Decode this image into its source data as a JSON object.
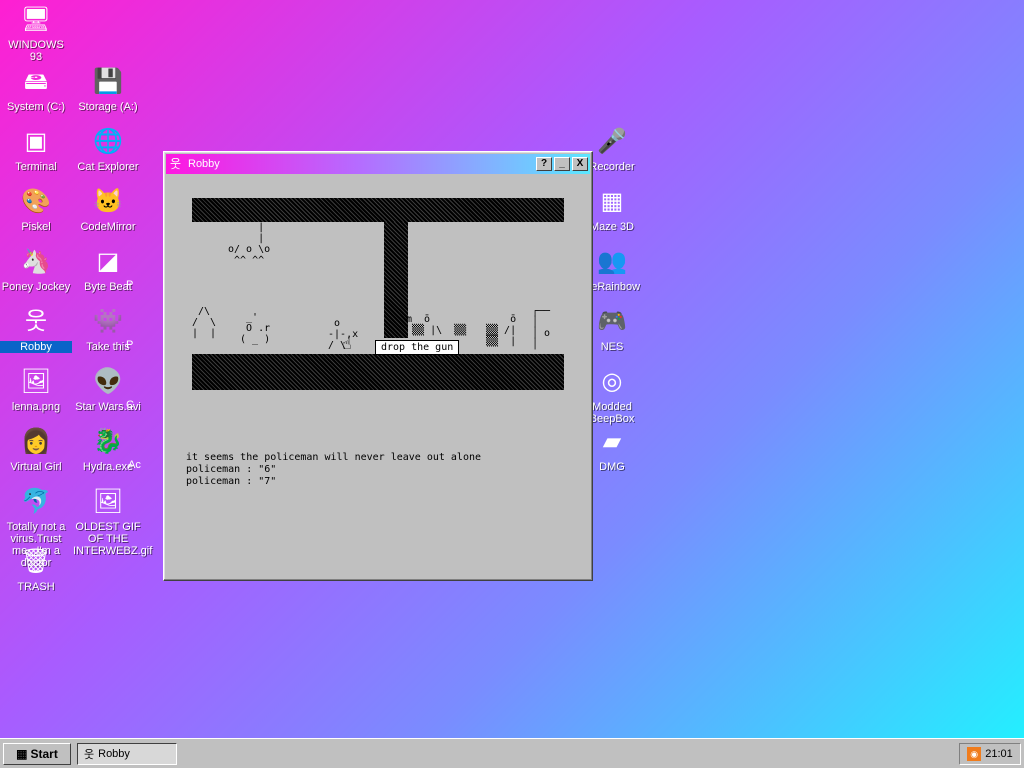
{
  "desktop": {
    "icons": [
      {
        "label": "WINDOWS 93",
        "glyph": "🖥",
        "icon": "computer-icon"
      },
      {
        "label": "System (C:)",
        "glyph": "🖴",
        "icon": "drive-icon"
      },
      {
        "label": "Storage (A:)",
        "glyph": "💾",
        "icon": "floppy-icon"
      },
      {
        "label": "Terminal",
        "glyph": "▣",
        "icon": "terminal-icon"
      },
      {
        "label": "Cat Explorer",
        "glyph": "🌐",
        "icon": "globe-icon"
      },
      {
        "label": "Piskel",
        "glyph": "🎨",
        "icon": "palette-icon"
      },
      {
        "label": "CodeMirror",
        "glyph": "🐱",
        "icon": "cat-icon"
      },
      {
        "label": "Poney Jockey",
        "glyph": "🦄",
        "icon": "pony-icon"
      },
      {
        "label": "Byte Beat",
        "glyph": "◪",
        "icon": "bytebeat-icon"
      },
      {
        "label": "Robby",
        "glyph": "웃",
        "icon": "stickman-icon"
      },
      {
        "label": "Take this",
        "glyph": "👾",
        "icon": "monster-icon"
      },
      {
        "label": "lenna.png",
        "glyph": "🖼",
        "icon": "image-file-icon"
      },
      {
        "label": "Star Wars.avi",
        "glyph": "👽",
        "icon": "yoda-icon"
      },
      {
        "label": "Virtual Girl",
        "glyph": "👩",
        "icon": "face-icon"
      },
      {
        "label": "Hydra.exe",
        "glyph": "🐉",
        "icon": "dragon-icon"
      },
      {
        "label": "Totally not a virus.Trust me...I'm a doctor",
        "glyph": "🐬",
        "icon": "dolphin-icon"
      },
      {
        "label": "OLDEST GIF OF THE INTERWEBZ.gif",
        "glyph": "🖼",
        "icon": "gif-file-icon"
      },
      {
        "label": "TRASH",
        "glyph": "🗑",
        "icon": "trash-icon"
      },
      {
        "label": "Recorder",
        "glyph": "🎤",
        "icon": "microphone-icon"
      },
      {
        "label": "Maze 3D",
        "glyph": "▦",
        "icon": "maze-icon"
      },
      {
        "label": "KeRainbow",
        "glyph": "👥",
        "icon": "people-icon"
      },
      {
        "label": "NES",
        "glyph": "🎮",
        "icon": "nes-icon"
      },
      {
        "label": "Modded BeepBox",
        "glyph": "◎",
        "icon": "ring-icon"
      },
      {
        "label": "DMG",
        "glyph": "▰",
        "icon": "gameboy-icon"
      }
    ],
    "partial_labels": [
      "P",
      "P",
      "C",
      "Ac"
    ]
  },
  "window": {
    "title": "Robby",
    "help_label": "?",
    "minimize_label": "_",
    "close_label": "X"
  },
  "game": {
    "tooltip": "drop the gun",
    "log": [
      "it seems the policeman will never leave out alone",
      "policeman : \"6\"",
      "policeman : \"7\""
    ]
  },
  "taskbar": {
    "start_label": "Start",
    "task_label": "Robby",
    "clock": "21:01"
  }
}
